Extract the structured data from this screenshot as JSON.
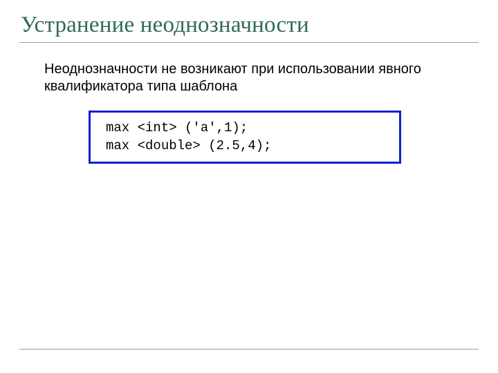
{
  "slide": {
    "title": "Устранение неоднозначности",
    "body": "Неоднозначности не возникают при использовании явного квалификатора типа шаблона",
    "code": "max <int> ('a',1);\nmax <double> (2.5,4);"
  }
}
